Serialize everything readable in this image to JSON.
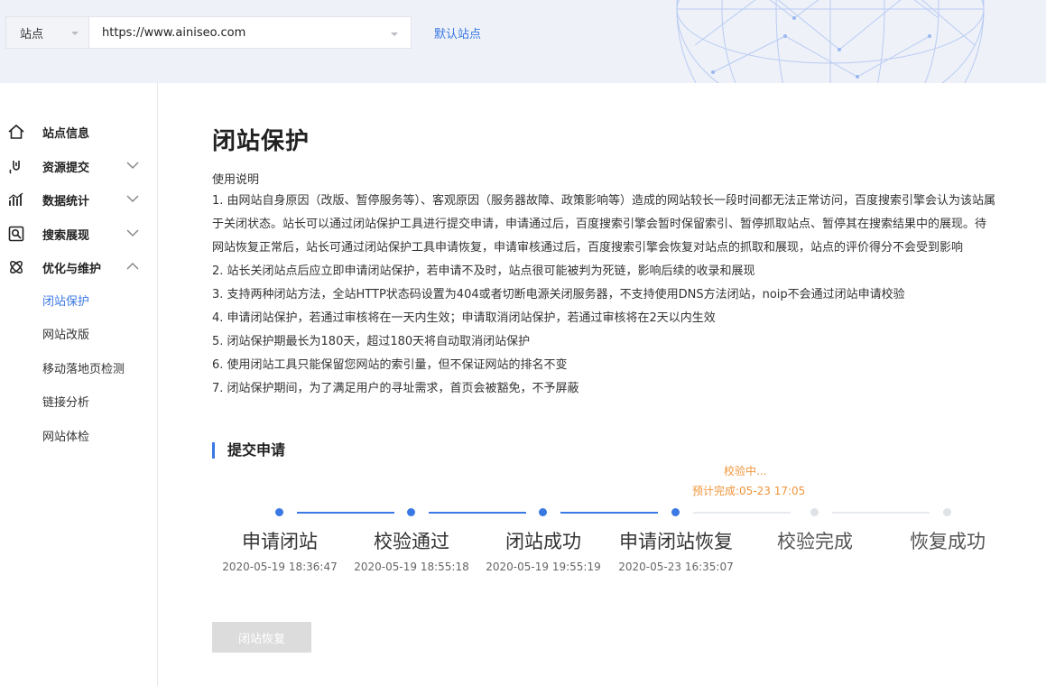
{
  "header": {
    "site_label": "站点",
    "url_value": "https://www.ainiseo.com",
    "default_site_link": "默认站点"
  },
  "sidebar": {
    "items": [
      {
        "label": "站点信息",
        "icon": "home-icon"
      },
      {
        "label": "资源提交",
        "icon": "link-icon"
      },
      {
        "label": "数据统计",
        "icon": "chart-icon"
      },
      {
        "label": "搜索展现",
        "icon": "search-view-icon"
      },
      {
        "label": "优化与维护",
        "icon": "tools-icon"
      }
    ],
    "subitems": [
      "闭站保护",
      "网站改版",
      "移动落地页检测",
      "链接分析",
      "网站体检"
    ],
    "active_subitem": "闭站保护"
  },
  "main": {
    "title": "闭站保护",
    "usage_title": "使用说明",
    "rules": [
      "1. 由网站自身原因（改版、暂停服务等）、客观原因（服务器故障、政策影响等）造成的网站较长一段时间都无法正常访问，百度搜索引擎会认为该站属于关闭状态。站长可以通过闭站保护工具进行提交申请，申请通过后，百度搜索引擎会暂时保留索引、暂停抓取站点、暂停其在搜索结果中的展现。待网站恢复正常后，站长可通过闭站保护工具申请恢复，申请审核通过后，百度搜索引擎会恢复对站点的抓取和展现，站点的评价得分不会受到影响",
      "2. 站长关闭站点后应立即申请闭站保护，若申请不及时，站点很可能被判为死链，影响后续的收录和展现",
      "3. 支持两种闭站方法，全站HTTP状态码设置为404或者切断电源关闭服务器，不支持使用DNS方法闭站，noip不会通过闭站申请校验",
      "4. 申请闭站保护，若通过审核将在一天内生效；申请取消闭站保护，若通过审核将在2天以内生效",
      "5. 闭站保护期最长为180天，超过180天将自动取消闭站保护",
      "6. 使用闭站工具只能保留您网站的索引量，但不保证网站的排名不变",
      "7. 闭站保护期间，为了满足用户的寻址需求，首页会被豁免，不予屏蔽"
    ],
    "section_title": "提交申请",
    "status_note": {
      "status": "校验中...",
      "eta": "预计完成:05-23 17:05"
    },
    "steps": [
      {
        "label": "申请闭站",
        "time": "2020-05-19 18:36:47",
        "done": true
      },
      {
        "label": "校验通过",
        "time": "2020-05-19 18:55:18",
        "done": true
      },
      {
        "label": "闭站成功",
        "time": "2020-05-19 19:55:19",
        "done": true
      },
      {
        "label": "申请闭站恢复",
        "time": "2020-05-23 16:35:07",
        "done": true
      },
      {
        "label": "校验完成",
        "time": "",
        "done": false
      },
      {
        "label": "恢复成功",
        "time": "",
        "done": false
      }
    ],
    "restore_button": "闭站恢复"
  },
  "colors": {
    "accent": "#3a78e3",
    "pending": "#f0953a",
    "disabled": "#dcdcdc"
  }
}
